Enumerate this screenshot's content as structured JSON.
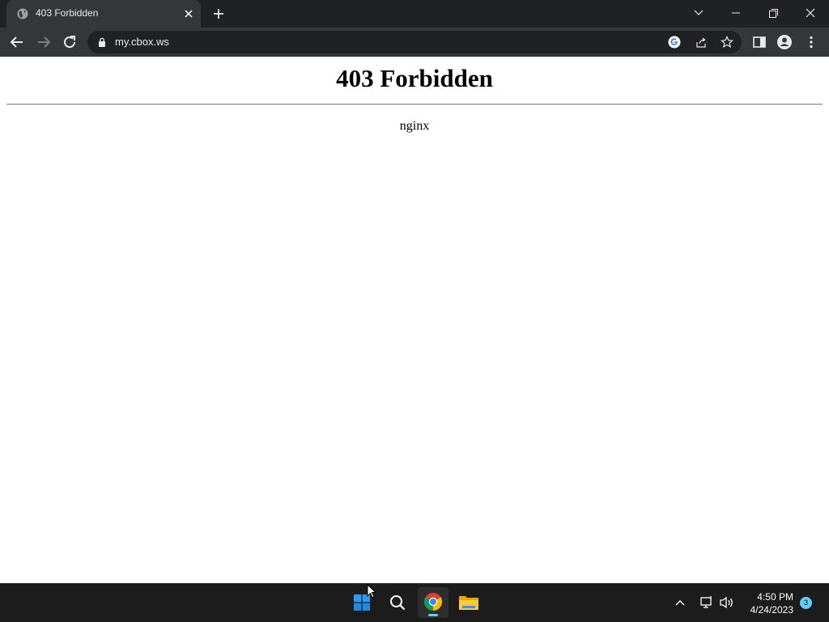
{
  "browser": {
    "tab": {
      "title": "403 Forbidden"
    },
    "address_bar": {
      "url": "my.cbox.ws"
    }
  },
  "page": {
    "heading": "403 Forbidden",
    "server": "nginx"
  },
  "taskbar": {
    "clock": {
      "time": "4:50 PM",
      "date": "4/24/2023"
    },
    "notifications": {
      "count": "3"
    }
  },
  "colors": {
    "titlebar": "#202124",
    "toolbar": "#35363a",
    "taskbar": "#1c1c1c",
    "accent": "#60cdff"
  }
}
